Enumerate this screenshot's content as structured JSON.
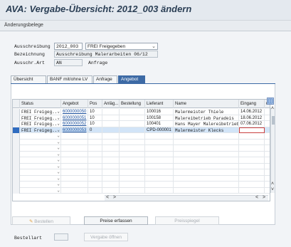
{
  "window": {
    "title": "AVA: Vergabe-Übersicht: 2012_003 ändern"
  },
  "toolbar": {
    "items": [
      "Änderungsbelege"
    ]
  },
  "header": {
    "ausschreibung_label": "Ausschreibung",
    "ausschreibung_value": "2012_003",
    "status_value": "FREI Freigegeben",
    "bezeichnung_label": "Bezeichnung",
    "bezeichnung_value": "Ausschreibung Malerarbeiten 06/12",
    "art_label": "Ausschr.Art",
    "art_value": "AN",
    "art_text": "Anfrage"
  },
  "tabs": [
    {
      "label": "Übersicht",
      "active": false
    },
    {
      "label": "BANF mit/ohne LV",
      "active": false
    },
    {
      "label": "Anfrage",
      "active": false
    },
    {
      "label": "Angebot",
      "active": true
    }
  ],
  "table": {
    "columns": [
      "Status",
      "Angebot",
      "Pos",
      "Anläg...",
      "Bestellung",
      "Lieferant",
      "Name",
      "Eingang",
      "u"
    ],
    "rows": [
      {
        "status": "FREI Freigeg...",
        "angebot": "6000000050",
        "pos": "10",
        "lieferant": "100016",
        "name": "Malermeister Thiele",
        "eingang": "14.06.2012"
      },
      {
        "status": "FREI Freigeg...",
        "angebot": "6000000051",
        "pos": "10",
        "lieferant": "100158",
        "name": "Malereibetrieb Paradeis",
        "eingang": "18.06.2012"
      },
      {
        "status": "FREI Freigeg...",
        "angebot": "6000000052",
        "pos": "10",
        "lieferant": "100401",
        "name": "Hans Mayer Malereibetrieb",
        "eingang": "07.06.2012"
      },
      {
        "status": "FREI Freigeg...",
        "angebot": "6000000053",
        "pos": "0",
        "lieferant": "CPD-000001",
        "name": "Malermeister Klecks",
        "eingang": ""
      }
    ],
    "empty_rows": 10
  },
  "buttons": {
    "bestellen": "Bestellen",
    "preise_erfassen": "Preise erfassen",
    "preisspiegel": "Preisspiegel",
    "vergabe_oeffnen": "Vergabe öffnen"
  },
  "bestellart": {
    "label": "Bestellart",
    "value": ""
  },
  "colors": {
    "accent": "#3d6aa5",
    "link": "#1a4f9c",
    "title": "#2b3f55"
  }
}
